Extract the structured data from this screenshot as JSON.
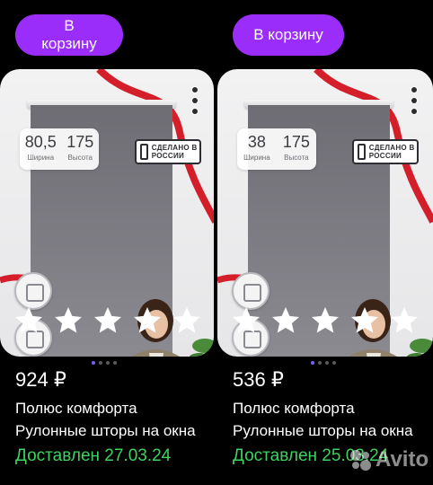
{
  "products": [
    {
      "cart_label": "В корзину",
      "size": {
        "width_value": "80,5",
        "width_label": "Ширина",
        "height_value": "175",
        "height_label": "Высота"
      },
      "badge_text": "СДЕЛАНО В РОССИИ",
      "price": "924 ₽",
      "brand": "Полюс комфорта",
      "title": "Рулонные шторы на окна",
      "delivery": "Доставлен 27.03.24",
      "rating_stars": 5
    },
    {
      "cart_label": "В корзину",
      "size": {
        "width_value": "38",
        "width_label": "Ширина",
        "height_value": "175",
        "height_label": "Высота"
      },
      "badge_text": "СДЕЛАНО В РОССИИ",
      "price": "536 ₽",
      "brand": "Полюс комфорта",
      "title": "Рулонные шторы на окна",
      "delivery": "Доставлен 25.03.24",
      "rating_stars": 5
    }
  ],
  "watermark": "Avito",
  "colors": {
    "accent": "#9b2dfa",
    "delivered": "#3dd35f",
    "ribbon": "#d41f2a"
  }
}
